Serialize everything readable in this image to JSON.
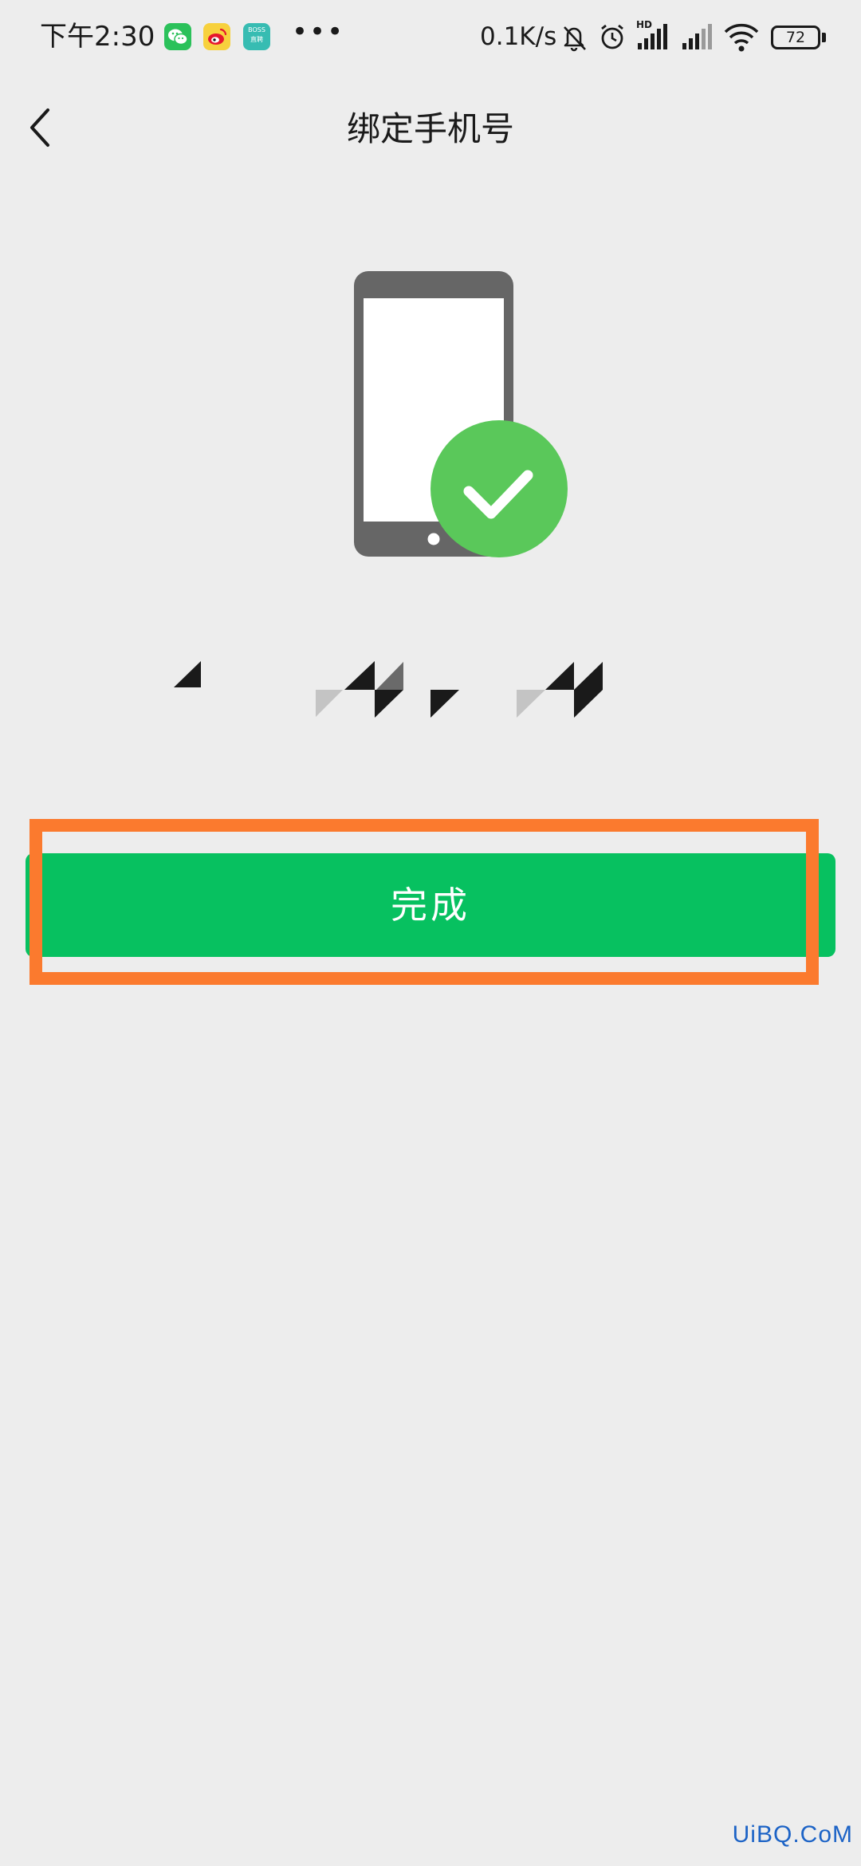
{
  "status_bar": {
    "time": "下午2:30",
    "apps": [
      {
        "name": "wechat",
        "icon": "wechat-icon",
        "color": "#2bc15a"
      },
      {
        "name": "weibo",
        "icon": "weibo-icon",
        "color": "#f7d13d"
      },
      {
        "name": "boss",
        "icon": "boss-zhipin-icon",
        "text": "BOSS\n直聘",
        "color": "#37bcb2"
      }
    ],
    "more": "•••",
    "net_speed": "0.1K/s",
    "network_type": "HD",
    "battery": "72"
  },
  "nav": {
    "back_icon": "chevron-left-icon",
    "title": "绑定手机号"
  },
  "illustration": {
    "phone_icon": "smartphone-icon",
    "check_icon": "check-circle-icon",
    "phone_color": "#666666",
    "check_color": "#5ac85a"
  },
  "phone_number": {
    "masked": true
  },
  "done_button": {
    "label": "完成",
    "color": "#07c160",
    "highlight_color": "#fb7a2e"
  },
  "watermark": {
    "text": "UiBQ.CoM"
  }
}
